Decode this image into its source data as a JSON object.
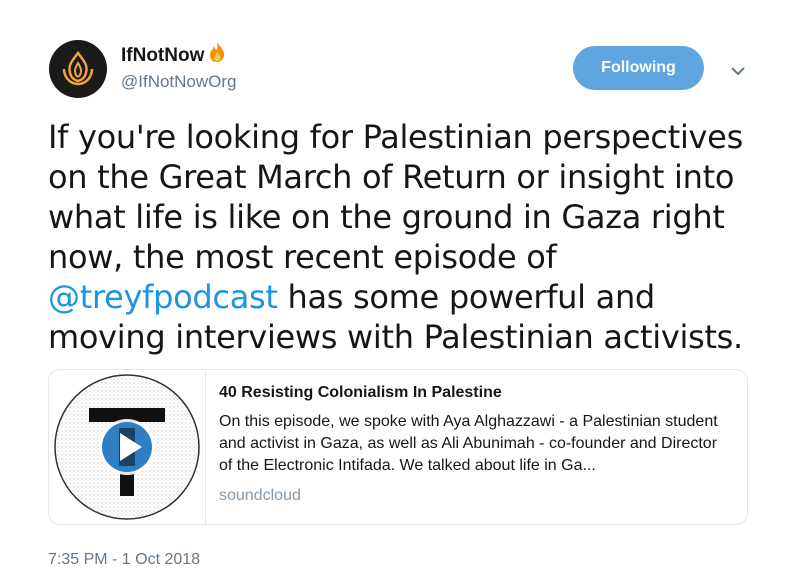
{
  "user": {
    "display_name": "IfNotNow",
    "handle": "@IfNotNowOrg",
    "avatar_icon": "flame-logo-icon",
    "name_emoji": "fire-emoji-icon"
  },
  "follow_button": {
    "label": "Following",
    "color": "#5fa6e1"
  },
  "menu_icon": "chevron-down-icon",
  "tweet": {
    "text_before": "If you're looking for Palestinian perspectives on the Great March of Return or insight into what life is like on the ground in Gaza right now, the most recent episode of ",
    "mention": "@treyfpodcast",
    "text_after": " has some powerful and moving interviews with Palestinian activists.",
    "mention_color": "#1b95e0"
  },
  "card": {
    "thumbnail_icon": "podcast-play-icon",
    "title": "40 Resisting Colonialism In Palestine",
    "description": "On this episode, we spoke with Aya Alghazzawi - a Palestinian student and activist in Gaza, as well as Ali Abunimah - co-founder and Director of the Electronic Intifada. We talked about life in Ga...",
    "domain": "soundcloud"
  },
  "timestamp": "7:35 PM - 1 Oct 2018"
}
